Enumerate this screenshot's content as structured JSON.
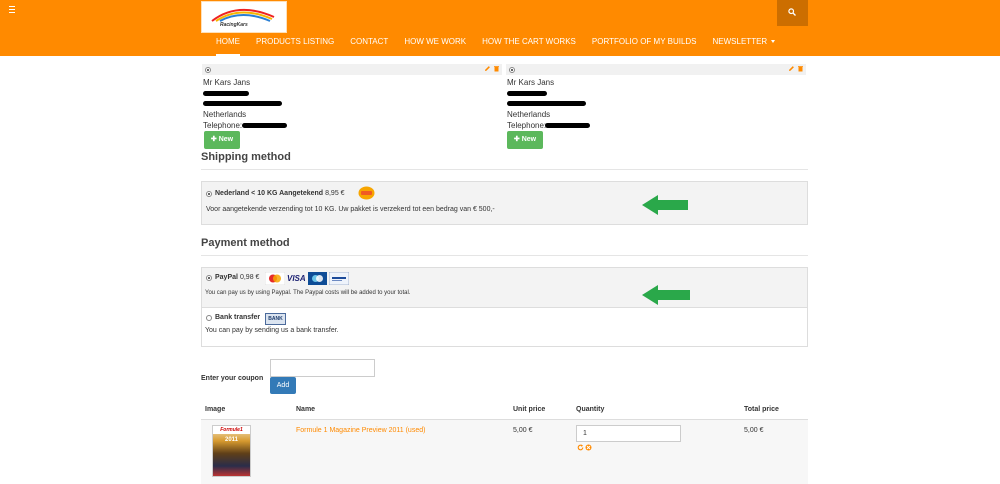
{
  "header": {
    "logo_text": "RacingKars",
    "nav": [
      {
        "label": "HOME",
        "active": true
      },
      {
        "label": "PRODUCTS LISTING"
      },
      {
        "label": "CONTACT"
      },
      {
        "label": "HOW WE WORK"
      },
      {
        "label": "HOW THE CART WORKS"
      },
      {
        "label": "PORTFOLIO OF MY BUILDS"
      },
      {
        "label": "NEWSLETTER",
        "dropdown": true
      }
    ]
  },
  "addresses": [
    {
      "name": "Mr Kars Jans",
      "country": "Netherlands",
      "telephone_label": "Telephone:",
      "new_label": "New"
    },
    {
      "name": "Mr Kars Jans",
      "country": "Netherlands",
      "telephone_label": "Telephone:",
      "new_label": "New"
    }
  ],
  "shipping": {
    "title": "Shipping method",
    "option_label": "Nederland < 10 KG Aangetekend",
    "option_price": "8,95 €",
    "option_desc": "Voor aangetekende verzending tot 10 KG. Uw pakket is verzekerd tot een bedrag van € 500,-"
  },
  "payment": {
    "title": "Payment method",
    "options": [
      {
        "label": "PayPal",
        "price": "0,98 €",
        "desc": "You can pay us by using Paypal. The Paypal costs will be added to your total.",
        "checked": true
      },
      {
        "label": "Bank transfer",
        "desc": "You can pay by sending us a bank transfer.",
        "checked": false
      }
    ],
    "card_badges": {
      "visa": "VISA",
      "bank": "BANK"
    }
  },
  "coupon": {
    "label": "Enter your coupon",
    "placeholder": "",
    "add_label": "Add"
  },
  "cart": {
    "headers": {
      "image": "Image",
      "name": "Name",
      "unit_price": "Unit price",
      "quantity": "Quantity",
      "total_price": "Total price"
    },
    "rows": [
      {
        "thumb_brand": "Formule1",
        "thumb_year": "2011",
        "name": "Formule 1 Magazine Preview 2011 (used)",
        "unit_price": "5,00 €",
        "quantity": "1",
        "total_price": "5,00 €"
      }
    ]
  },
  "colors": {
    "brand": "#ff8a00",
    "green": "#5cb85c",
    "blue": "#337ab7",
    "arrow": "#2aa84a"
  }
}
